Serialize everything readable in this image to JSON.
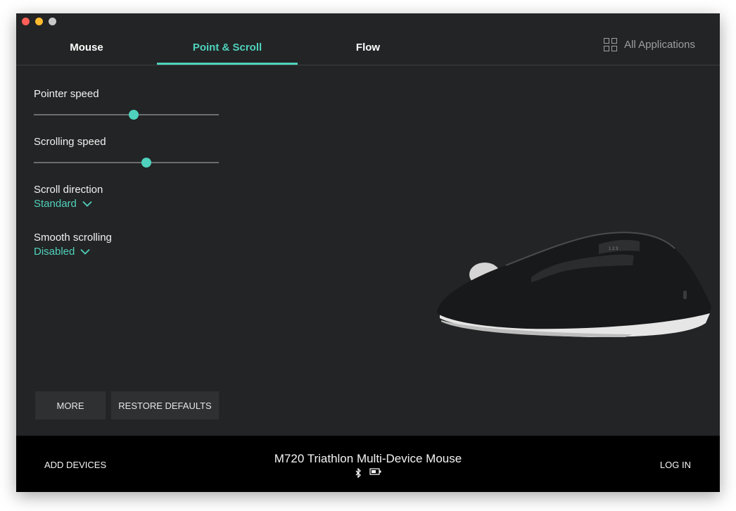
{
  "tabs": [
    {
      "label": "Mouse"
    },
    {
      "label": "Point & Scroll"
    },
    {
      "label": "Flow"
    }
  ],
  "all_applications_label": "All Applications",
  "settings": {
    "pointer_speed": {
      "label": "Pointer speed",
      "value": 0.54
    },
    "scrolling_speed": {
      "label": "Scrolling speed",
      "value": 0.61
    },
    "scroll_direction": {
      "label": "Scroll direction",
      "value": "Standard"
    },
    "smooth_scrolling": {
      "label": "Smooth scrolling",
      "value": "Disabled"
    }
  },
  "buttons": {
    "more": "MORE",
    "restore_defaults": "RESTORE DEFAULTS"
  },
  "footer": {
    "add_devices": "ADD DEVICES",
    "device_name": "M720 Triathlon Multi-Device Mouse",
    "log_in": "LOG IN",
    "status_icons": [
      "bluetooth-icon",
      "battery-icon"
    ]
  },
  "colors": {
    "accent": "#4fd2bd",
    "background": "#232425",
    "footer": "#000000"
  }
}
